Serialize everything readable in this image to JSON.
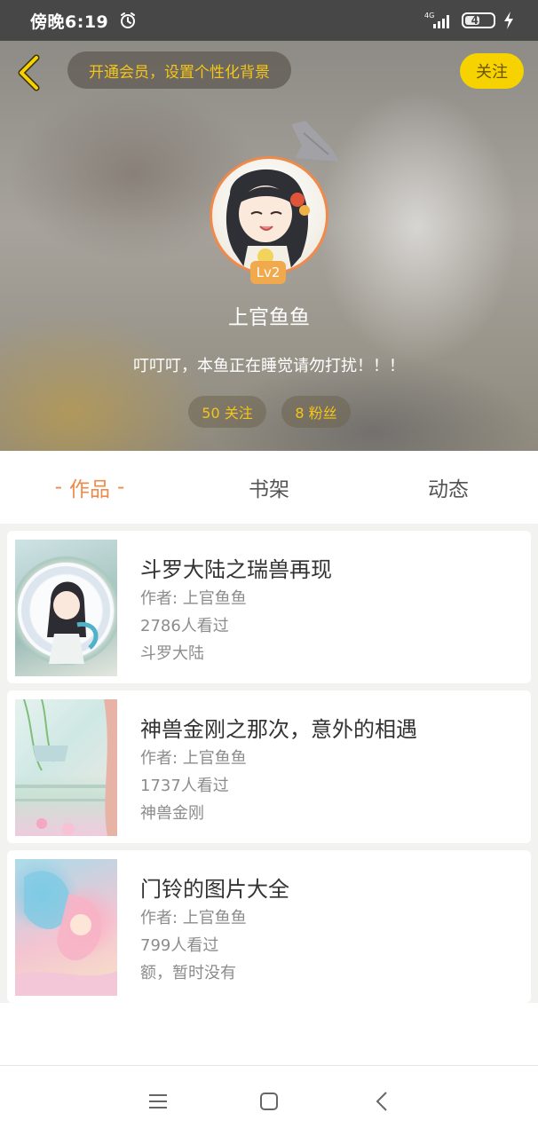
{
  "status_bar": {
    "time": "傍晚6:19",
    "network": "4G",
    "battery": "42"
  },
  "header": {
    "vip_prompt": "开通会员，设置个性化背景",
    "follow_label": "关注",
    "level": "Lv2",
    "username": "上官鱼鱼",
    "bio": "叮叮叮，本鱼正在睡觉请勿打扰！！！",
    "stats": {
      "following": "50 关注",
      "fans": "8 粉丝"
    }
  },
  "tabs": [
    {
      "label": "作品",
      "active": true,
      "dash": "-"
    },
    {
      "label": "书架",
      "active": false
    },
    {
      "label": "动态",
      "active": false
    }
  ],
  "works": [
    {
      "title": "斗罗大陆之瑞兽再现",
      "author": "作者: 上官鱼鱼",
      "views": "2786人看过",
      "category": "斗罗大陆"
    },
    {
      "title": "神兽金刚之那次，意外的相遇",
      "author": "作者: 上官鱼鱼",
      "views": "1737人看过",
      "category": "神兽金刚"
    },
    {
      "title": "门铃的图片大全",
      "author": "作者: 上官鱼鱼",
      "views": "799人看过",
      "category": "额，暂时没有"
    }
  ],
  "icons": {
    "back": "chevron-left-icon",
    "crown": "crown-icon",
    "alarm": "alarm-clock-icon",
    "signal": "signal-icon",
    "battery": "battery-icon",
    "charging": "bolt-icon",
    "nav_menu": "menu-icon",
    "nav_home": "square-home-icon",
    "nav_back": "back-triangle-icon"
  },
  "colors": {
    "accent_orange": "#ee8a4a",
    "follow_yellow": "#f5d200",
    "vip_text": "#f5c518"
  }
}
